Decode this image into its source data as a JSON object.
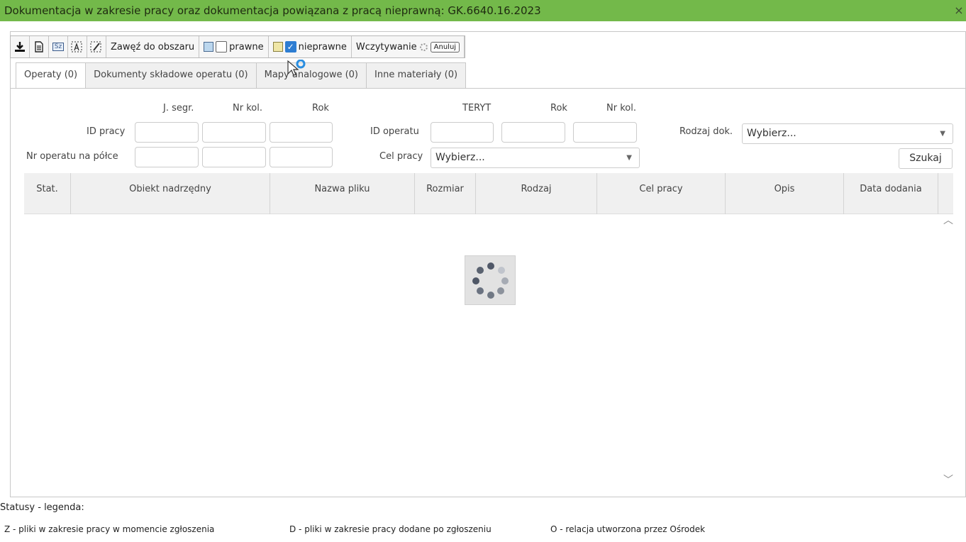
{
  "window": {
    "title": "Dokumentacja w zakresie pracy oraz dokumentacja powiązana z pracą nieprawną: GK.6640.16.2023",
    "close": "×"
  },
  "toolbar": {
    "zoom_label": "Zawęź do obszaru",
    "legal_label": "prawne",
    "illegal_label": "nieprawne",
    "illegal_checked": true,
    "legal_checked": false,
    "loading_label": "Wczytywanie",
    "cancel_label": "Anuluj",
    "icon_sz": "Sz"
  },
  "tabs": [
    {
      "label": "Operaty (0)",
      "active": true
    },
    {
      "label": "Dokumenty składowe operatu (0)",
      "active": false
    },
    {
      "label": "Mapy analogowe (0)",
      "active": false
    },
    {
      "label": "Inne materiały (0)",
      "active": false
    }
  ],
  "filters": {
    "col_j_segr": "J. segr.",
    "col_nr_kol": "Nr kol.",
    "col_rok": "Rok",
    "col_teryt": "TERYT",
    "col_rok2": "Rok",
    "col_nr_kol2": "Nr kol.",
    "id_pracy_label": "ID pracy",
    "nr_operatu_label": "Nr operatu na półce",
    "id_operatu_label": "ID operatu",
    "cel_pracy_label": "Cel pracy",
    "cel_pracy_value": "Wybierz...",
    "rodzaj_dok_label": "Rodzaj dok.",
    "rodzaj_dok_value": "Wybierz...",
    "search_label": "Szukaj"
  },
  "grid": {
    "columns": [
      "Stat.",
      "Obiekt nadrzędny",
      "Nazwa pliku",
      "Rozmiar",
      "Rodzaj",
      "Cel pracy",
      "Opis",
      "Data dodania"
    ],
    "rows": []
  },
  "legend": {
    "title": "Statusy - legenda:",
    "items": [
      "Z - pliki w zakresie pracy w momencie zgłoszenia",
      "D - pliki w zakresie pracy dodane po zgłoszeniu",
      "O - relacja utworzona przez Ośrodek"
    ]
  },
  "colors": {
    "titlebar": "#73b94a",
    "checkbox_checked": "#2d7dd2"
  }
}
